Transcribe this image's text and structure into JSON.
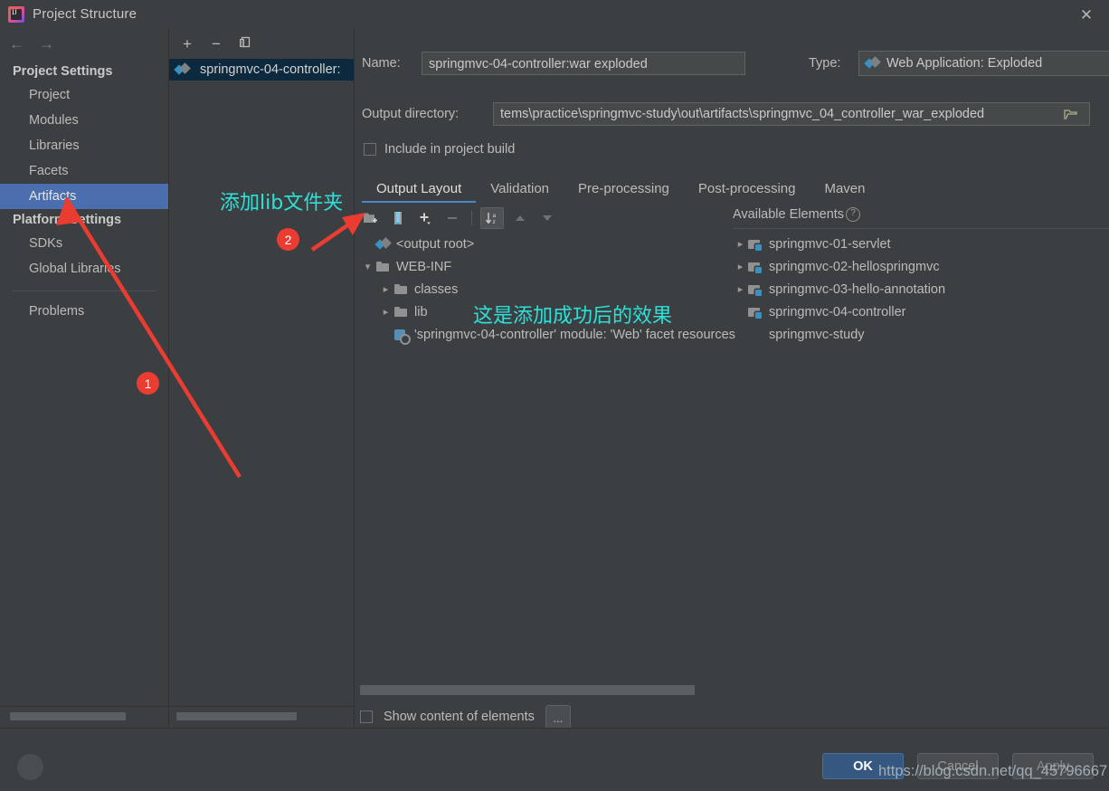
{
  "window": {
    "title": "Project Structure",
    "app_icon": "intellij-idea-icon",
    "close_icon": "close-icon"
  },
  "sidebar": {
    "back_icon": "arrow-left-icon",
    "forward_icon": "arrow-right-icon",
    "groups": [
      {
        "heading": "Project Settings",
        "items": [
          {
            "label": "Project",
            "selected": false
          },
          {
            "label": "Modules",
            "selected": false
          },
          {
            "label": "Libraries",
            "selected": false
          },
          {
            "label": "Facets",
            "selected": false
          },
          {
            "label": "Artifacts",
            "selected": true
          }
        ]
      },
      {
        "heading": "Platform Settings",
        "items": [
          {
            "label": "SDKs",
            "selected": false
          },
          {
            "label": "Global Libraries",
            "selected": false
          }
        ]
      }
    ],
    "problems": "Problems"
  },
  "artifacts_panel": {
    "toolbar": [
      {
        "name": "add-artifact-button",
        "glyph": "+"
      },
      {
        "name": "remove-artifact-button",
        "glyph": "−"
      },
      {
        "name": "copy-artifact-button",
        "glyph": "❐"
      }
    ],
    "selected_artifact": "springmvc-04-controller:",
    "artifact_icon": "artifact-exploded-icon"
  },
  "detail": {
    "name_label": "Name:",
    "name_value": "springmvc-04-controller:war exploded",
    "type_label": "Type:",
    "type_value": "Web Application: Exploded",
    "type_icon": "artifact-exploded-icon",
    "type_dropdown_icon": "chevron-down-icon",
    "output_dir_label": "Output directory:",
    "output_dir_value": "tems\\practice\\springmvc-study\\out\\artifacts\\springmvc_04_controller_war_exploded",
    "output_dir_browse_icon": "folder-open-icon",
    "include_in_build_label": "Include in project build",
    "include_in_build_checked": false,
    "tabs": [
      {
        "label": "Output Layout",
        "active": true
      },
      {
        "label": "Validation",
        "active": false
      },
      {
        "label": "Pre-processing",
        "active": false
      },
      {
        "label": "Post-processing",
        "active": false
      },
      {
        "label": "Maven",
        "active": false
      }
    ],
    "layout_toolbar": [
      {
        "name": "add-directory-content-button",
        "icon": "folder-add-icon",
        "state": "enabled"
      },
      {
        "name": "add-archive-button",
        "icon": "archive-jar-icon",
        "state": "enabled"
      },
      {
        "name": "add-element-button",
        "icon": "plus-dropdown-icon",
        "state": "enabled"
      },
      {
        "name": "remove-element-button",
        "icon": "minus-icon",
        "state": "disabled"
      },
      {
        "name": "sort-elements-button",
        "icon": "sort-az-icon",
        "state": "selected"
      },
      {
        "name": "move-up-button",
        "icon": "triangle-up-icon",
        "state": "disabled"
      },
      {
        "name": "move-down-button",
        "icon": "triangle-down-icon",
        "state": "disabled"
      }
    ],
    "output_tree": [
      {
        "label": "<output root>",
        "icon": "artifact-root-icon",
        "indent": 0,
        "twisty": "none"
      },
      {
        "label": "WEB-INF",
        "icon": "folder-icon",
        "indent": 0,
        "twisty": "expanded"
      },
      {
        "label": "classes",
        "icon": "folder-icon",
        "indent": 1,
        "twisty": "collapsed"
      },
      {
        "label": "lib",
        "icon": "folder-icon",
        "indent": 1,
        "twisty": "collapsed"
      },
      {
        "label": "'springmvc-04-controller' module: 'Web' facet resources",
        "icon": "facet-resources-icon",
        "indent": 1,
        "twisty": "none"
      }
    ],
    "available_elements_label": "Available Elements",
    "available_elements_help_icon": "question-mark-icon",
    "available_tree": [
      {
        "label": "springmvc-01-servlet",
        "icon": "module-icon",
        "twisty": "collapsed"
      },
      {
        "label": "springmvc-02-hellospringmvc",
        "icon": "module-icon",
        "twisty": "collapsed"
      },
      {
        "label": "springmvc-03-hello-annotation",
        "icon": "module-icon",
        "twisty": "collapsed"
      },
      {
        "label": "springmvc-04-controller",
        "icon": "module-icon",
        "twisty": "none"
      },
      {
        "label": "springmvc-study",
        "icon": "none",
        "twisty": "none"
      }
    ],
    "show_content_label": "Show content of elements",
    "show_content_checked": false,
    "more_button_label": "..."
  },
  "footer": {
    "help_icon": "question-mark-icon",
    "ok_label": "OK",
    "cancel_label": "Cancel",
    "apply_label": "Apply"
  },
  "annotations": {
    "note_add_lib": "添加lib文件夹",
    "note_result": "这是添加成功后的效果",
    "badge_one": "1",
    "badge_two": "2",
    "accent_color": "#2de0d8",
    "marker_color": "#ea3c31",
    "watermark": "https://blog.csdn.net/qq_45796667"
  }
}
